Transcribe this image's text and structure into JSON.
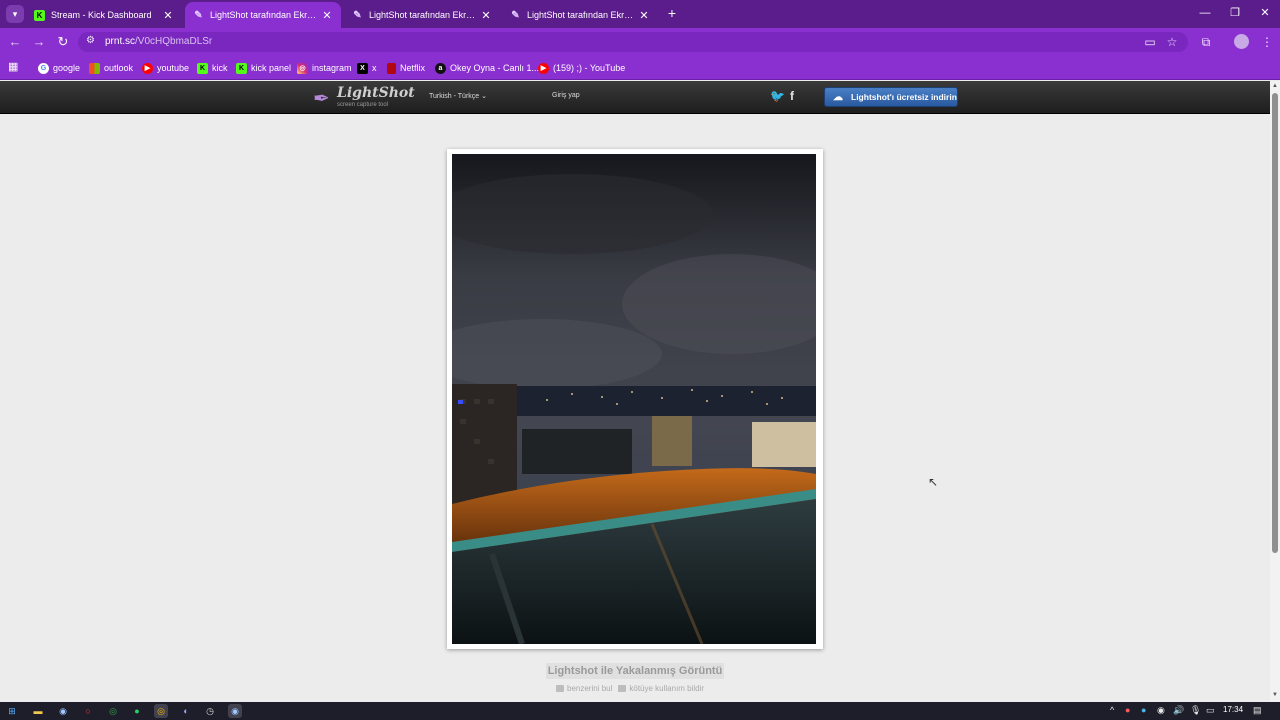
{
  "browser": {
    "tabs": [
      {
        "title": "Stream - Kick Dashboard",
        "icon": "kick-icon",
        "active": false
      },
      {
        "title": "LightShot tarafından Ekran Gör",
        "icon": "feather-icon",
        "active": true
      },
      {
        "title": "LightShot tarafından Ekran Gör",
        "icon": "feather-icon",
        "active": false
      },
      {
        "title": "LightShot tarafından Ekran Gör",
        "icon": "feather-icon",
        "active": false
      }
    ],
    "url_host": "prnt.sc",
    "url_path": "/V0cHQbmaDLSr",
    "bookmarks": [
      {
        "label": "google",
        "icon": "google-icon"
      },
      {
        "label": "outlook",
        "icon": "microsoft-icon"
      },
      {
        "label": "youtube",
        "icon": "youtube-icon"
      },
      {
        "label": "kick",
        "icon": "kick-icon"
      },
      {
        "label": "kick panel",
        "icon": "kick-icon"
      },
      {
        "label": "instagram",
        "icon": "instagram-icon"
      },
      {
        "label": "x",
        "icon": "x-icon"
      },
      {
        "label": "Netflix",
        "icon": "netflix-icon"
      },
      {
        "label": "Okey Oyna - Canlı 1...",
        "icon": "okey-icon"
      },
      {
        "label": "(159) ;) - YouTube",
        "icon": "youtube-icon"
      }
    ]
  },
  "lightshot": {
    "logo_name": "LightShot",
    "logo_tagline": "screen capture tool",
    "language": "Turkish - Türkçe",
    "login": "Giriş yap",
    "download_label": "Lightshot'ı ücretsiz indirin",
    "caption_title": "Lightshot ile Yakalanmış Görüntü",
    "find_similar": "benzerini bul",
    "report_abuse": "kötüye kullanım bildir"
  },
  "taskbar": {
    "clock": "17:34"
  },
  "colors": {
    "tabbar": "#5b1d8c",
    "toolbar": "#8a2fd0",
    "page_bg": "#ececec",
    "download_button": "#2a5aa0"
  }
}
